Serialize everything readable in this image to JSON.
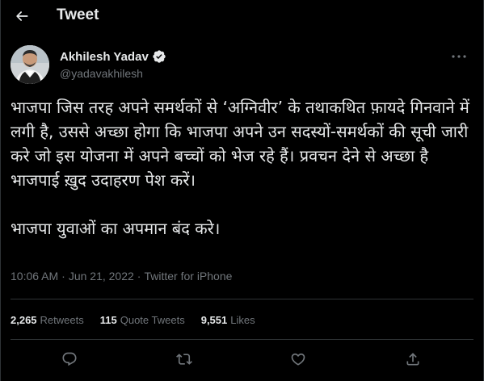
{
  "header": {
    "title": "Tweet",
    "back_icon": "arrow-left-icon"
  },
  "author": {
    "display_name": "Akhilesh Yadav",
    "handle": "@yadavakhilesh",
    "verified_icon": "verified-badge-icon",
    "more_icon": "more-horizontal-icon"
  },
  "tweet": {
    "paragraphs": [
      "भाजपा जिस तरह अपने समर्थकों से ‘अग्निवीर’ के तथाकथित फ़ायदे गिनवाने में लगी है, उससे अच्छा होगा कि भाजपा अपने उन सदस्यों-समर्थकों की सूची जारी करे जो इस योजना में अपने बच्चों को भेज रहे हैं। प्रवचन देने से अच्छा है भाजपाई ख़ुद उदाहरण पेश करें।",
      "भाजपा युवाओं का अपमान बंद करे।"
    ],
    "time": "10:06 AM",
    "separator": "·",
    "date": "Jun 21, 2022",
    "source": "Twitter for iPhone"
  },
  "stats": {
    "retweets": {
      "count": "2,265",
      "label": "Retweets"
    },
    "quote_tweets": {
      "count": "115",
      "label": "Quote Tweets"
    },
    "likes": {
      "count": "9,551",
      "label": "Likes"
    }
  },
  "actions": [
    "reply-icon",
    "retweet-icon",
    "like-icon",
    "share-icon"
  ],
  "colors": {
    "background": "#000000",
    "text_primary": "#e7e9ea",
    "text_secondary": "#71767b",
    "divider": "#2f3336",
    "verified_blue": "#1d9bf0"
  }
}
